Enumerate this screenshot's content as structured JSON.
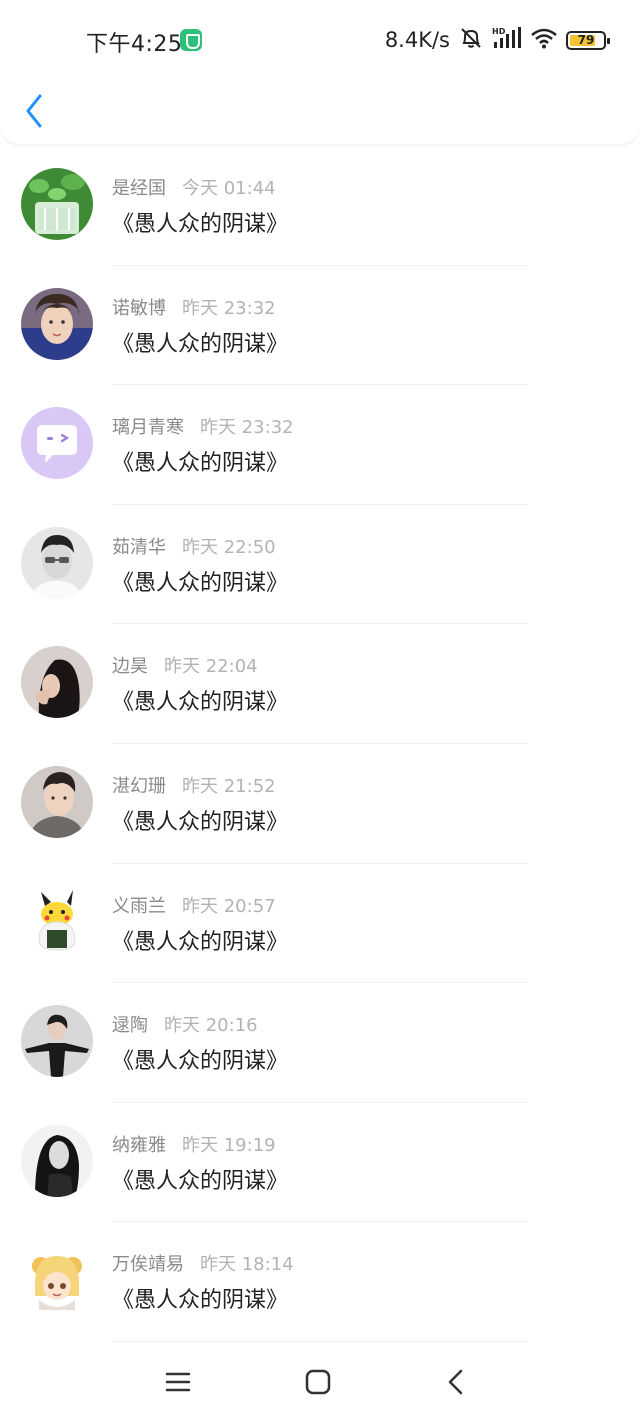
{
  "status_bar": {
    "time": "下午4:25",
    "network_speed": "8.4K/s",
    "battery": "79",
    "battery_level": 0.79,
    "icons": [
      "security-shield-icon",
      "bell-muted-icon",
      "hd-signal-icon",
      "wifi-icon",
      "battery-icon"
    ]
  },
  "header": {
    "back_icon": "chevron-left-icon"
  },
  "messages": [
    {
      "name": "是经国",
      "time": "今天 01:44",
      "text": "《愚人众的阴谋》"
    },
    {
      "name": "诺敏博",
      "time": "昨天 23:32",
      "text": "《愚人众的阴谋》"
    },
    {
      "name": "璃月青寒",
      "time": "昨天 23:32",
      "text": "《愚人众的阴谋》"
    },
    {
      "name": "茹清华",
      "time": "昨天 22:50",
      "text": "《愚人众的阴谋》"
    },
    {
      "name": "边昊",
      "time": "昨天 22:04",
      "text": "《愚人众的阴谋》"
    },
    {
      "name": "湛幻珊",
      "time": "昨天 21:52",
      "text": "《愚人众的阴谋》"
    },
    {
      "name": "义雨兰",
      "time": "昨天 20:57",
      "text": "《愚人众的阴谋》"
    },
    {
      "name": "逯陶",
      "time": "昨天 20:16",
      "text": "《愚人众的阴谋》"
    },
    {
      "name": "纳雍雅",
      "time": "昨天 19:19",
      "text": "《愚人众的阴谋》"
    },
    {
      "name": "万俟靖易",
      "time": "昨天 18:14",
      "text": "《愚人众的阴谋》"
    }
  ],
  "nav_bar": {
    "icons": [
      "menu-icon",
      "home-square-icon",
      "back-triangle-icon"
    ]
  },
  "colors": {
    "accent": "#1e90ff",
    "name_text": "#8a8a8a",
    "time_text": "#b3b3b3",
    "message_text": "#222222",
    "battery_fill": "#f4c430"
  }
}
